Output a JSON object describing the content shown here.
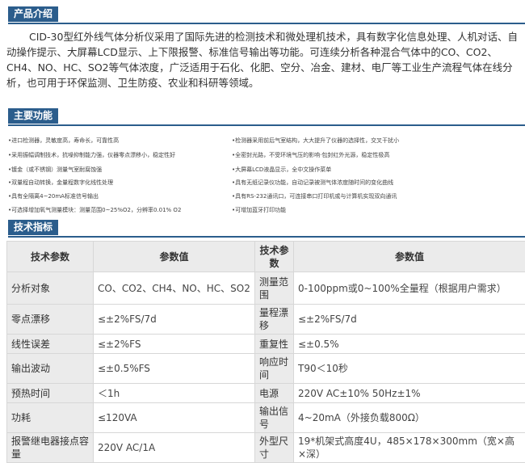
{
  "sections": {
    "intro_title": "产品介绍",
    "features_title": "主要功能",
    "specs_title": "技术指标"
  },
  "intro_text": "CID-30型红外线气体分析仪采用了国际先进的检测技术和微处理机技术，具有数字化信息处理、人机对话、自动操作提示、大屏幕LCD显示、上下限报警、标准信号输出等功能。可连续分析各种混合气体中的CO、CO2、CH4、NO、HC、SO2等气体浓度，广泛适用于石化、化肥、空分、冶金、建材、电厂等工业生产流程气体在线分析，也可用于环保监测、卫生防疫、农业和科研等领域。",
  "features": {
    "left": [
      "•进口检测器，灵敏度高，寿命长，可靠性高",
      "•采用振幅调制技术，抗噪抑制能力强，仪器零点漂移小，稳定性好",
      "•镀金（或不锈钢）测量气室耐腐蚀强",
      "•双量程自动转换，金量程数字化线性处理",
      "•具有全隔离4~20mA标准信号输出",
      "•可选择增加氧气测量模块：测量范围0~25%O2，分辨率0.01% O2"
    ],
    "right": [
      "•检测器采用前后气室结构，大大提升了仪器的选择性，交叉干扰小",
      "•全密封光路，不受环境气压的影响·包封红外光源，稳定性极高",
      "•大屏幕LCD液晶显示，全中文操作菜单",
      "•具有无纸记录仪功能，自动记录被测气体浓度随时间的变化曲线",
      "•具有RS-232通讯口，可连接串口打印机或与计算机实现双向通讯",
      "•可增加蓝牙打印功能"
    ]
  },
  "specs": {
    "header": [
      "技术参数",
      "参数值",
      "技术参数",
      "参数值"
    ],
    "rows": [
      [
        "分析对象",
        "CO、CO2、CH4、NO、HC、SO2",
        "测量范围",
        "0-100ppm或0~100%全量程（根据用户需求）"
      ],
      [
        "零点漂移",
        "≤±2%FS/7d",
        "量程漂移",
        "≤±2%FS/7d"
      ],
      [
        "线性误差",
        "≤±2%FS",
        "重复性",
        "≤±0.5%"
      ],
      [
        "输出波动",
        "≤±0.5%FS",
        "响应时间",
        "T90＜10秒"
      ],
      [
        "预热时间",
        "＜1h",
        "电源",
        "220V AC±10% 50Hz±1%"
      ],
      [
        "功耗",
        "≤120VA",
        "输出信号",
        "4~20mA（外接负载800Ω）"
      ],
      [
        "报警继电器接点容量",
        "220V AC/1A",
        "外型尺寸",
        "19*机架式高度4U，485×178×300mm（宽×高×深）"
      ]
    ]
  }
}
